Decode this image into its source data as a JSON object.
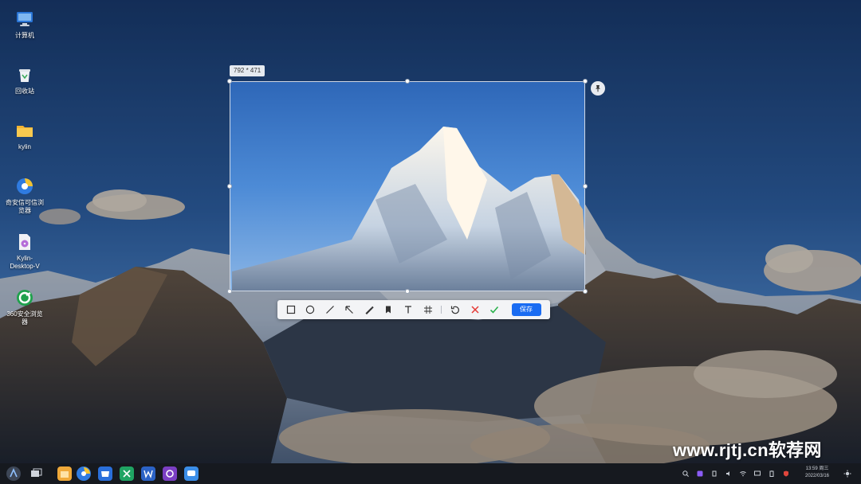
{
  "desktop": {
    "icons": [
      {
        "label": "计算机",
        "icon": "computer-icon"
      },
      {
        "label": "回收站",
        "icon": "trash-icon"
      },
      {
        "label": "kylin",
        "icon": "folder-icon"
      },
      {
        "label": "奇安信可信浏览器",
        "icon": "browser-icon"
      },
      {
        "label": "Kylin-Desktop-V",
        "icon": "iso-file-icon"
      },
      {
        "label": "360安全浏览器",
        "icon": "360-browser-icon"
      }
    ]
  },
  "screenshot_tool": {
    "size_label": "792 * 471",
    "tools": [
      {
        "name": "rectangle",
        "icon": "rectangle-icon"
      },
      {
        "name": "ellipse",
        "icon": "ellipse-icon"
      },
      {
        "name": "line",
        "icon": "line-icon"
      },
      {
        "name": "arrow",
        "icon": "arrow-icon"
      },
      {
        "name": "pen",
        "icon": "pen-icon"
      },
      {
        "name": "marker",
        "icon": "marker-icon"
      },
      {
        "name": "text",
        "icon": "text-icon"
      },
      {
        "name": "mosaic",
        "icon": "mosaic-icon"
      },
      {
        "name": "undo",
        "icon": "undo-icon"
      },
      {
        "name": "cancel",
        "icon": "close-icon",
        "color": "#e53935"
      },
      {
        "name": "confirm",
        "icon": "check-icon",
        "color": "#2bb24c"
      }
    ],
    "save_label": "保存",
    "accent": "#1a6cf2"
  },
  "watermark": "www.rjtj.cn软荐网",
  "taskbar": {
    "apps": [
      {
        "icon": "start-menu-icon"
      },
      {
        "icon": "multitask-view-icon"
      },
      {
        "icon": "file-manager-icon"
      },
      {
        "icon": "browser-icon"
      },
      {
        "icon": "software-store-icon"
      },
      {
        "icon": "wps-spreadsheet-icon"
      },
      {
        "icon": "wps-writer-icon"
      },
      {
        "icon": "media-player-icon"
      },
      {
        "icon": "chat-app-icon"
      }
    ],
    "clock": {
      "time": "13:59 周三",
      "date": "2022/03/16"
    }
  }
}
